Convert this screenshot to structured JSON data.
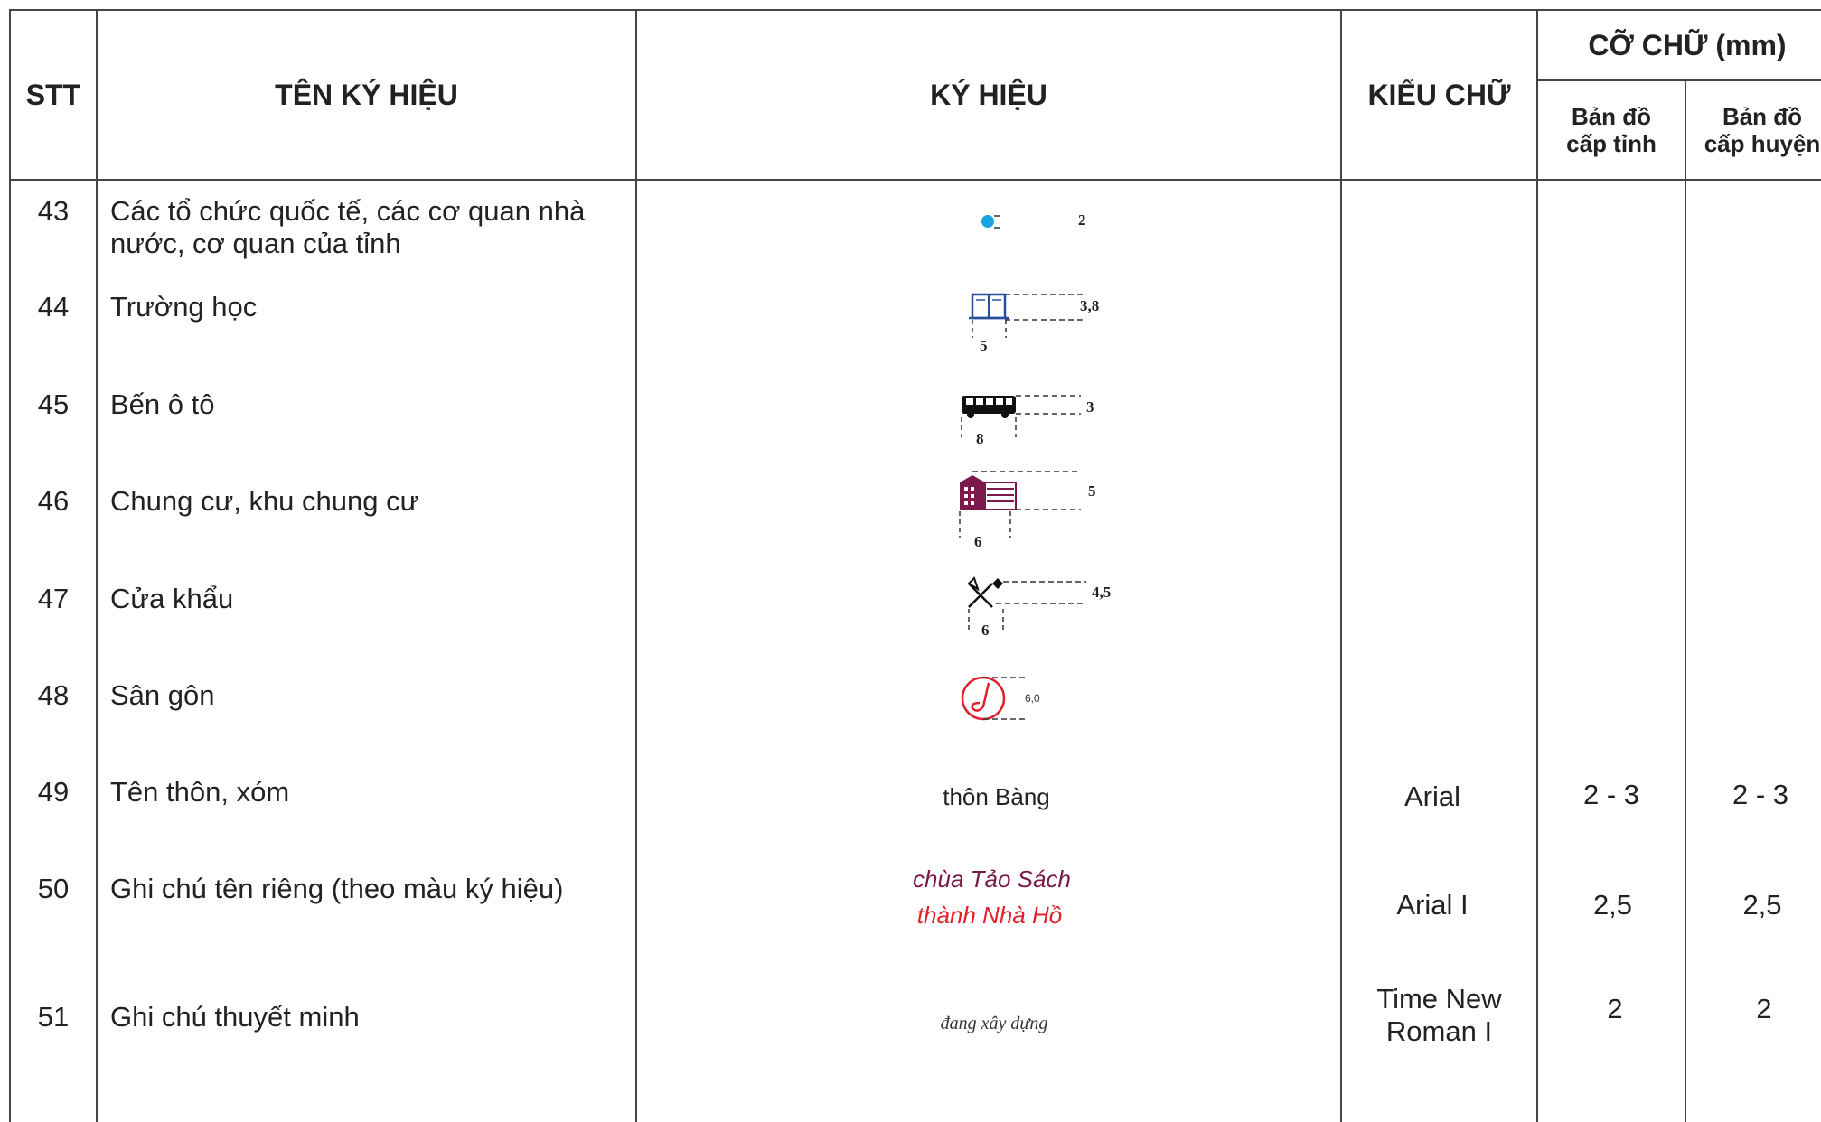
{
  "header": {
    "stt": "STT",
    "name": "TÊN KÝ HIỆU",
    "symbol": "KÝ HIỆU",
    "font_style": "KIỂU CHỮ",
    "font_size": "CỠ CHỮ (mm)",
    "province_line1": "Bản đồ",
    "province_line2": "cấp tỉnh",
    "district_line1": "Bản đồ",
    "district_line2": "cấp huyện"
  },
  "rows": [
    {
      "stt": "43",
      "name_line1": "Các tổ chức quốc tế, các cơ quan nhà",
      "name_line2": "nước, cơ quan của tỉnh",
      "dim": "2"
    },
    {
      "stt": "44",
      "name": "Trường học",
      "dim_h": "3,8",
      "dim_w": "5"
    },
    {
      "stt": "45",
      "name": "Bến ô tô",
      "dim_h": "3",
      "dim_w": "8"
    },
    {
      "stt": "46",
      "name": "Chung cư, khu chung cư",
      "dim_h": "5",
      "dim_w": "6"
    },
    {
      "stt": "47",
      "name": "Cửa khẩu",
      "dim_h": "4,5",
      "dim_w": "6"
    },
    {
      "stt": "48",
      "name": "Sân gôn",
      "dim": "6,0"
    },
    {
      "stt": "49",
      "name": "Tên thôn, xóm",
      "sample": "thôn Bàng",
      "font": "Arial",
      "province": "2 - 3",
      "district": "2 - 3"
    },
    {
      "stt": "50",
      "name": "Ghi chú tên riêng (theo màu ký hiệu)",
      "sample1": "chùa Tảo Sách",
      "sample2": "thành Nhà Hồ",
      "font": "Arial I",
      "province": "2,5",
      "district": "2,5"
    },
    {
      "stt": "51",
      "name": "Ghi chú thuyết minh",
      "sample": "đang xây dựng",
      "font_line1": "Time New",
      "font_line2": "Roman I",
      "province": "2",
      "district": "2"
    }
  ],
  "colors": {
    "cyan_dot": "#1aa3e0",
    "school_blue": "#2b4ea0",
    "apartment_maroon": "#7a1a4a",
    "golf_red": "#e0202a",
    "label_maroon": "#7a1a4a",
    "label_red": "#e0202a"
  }
}
